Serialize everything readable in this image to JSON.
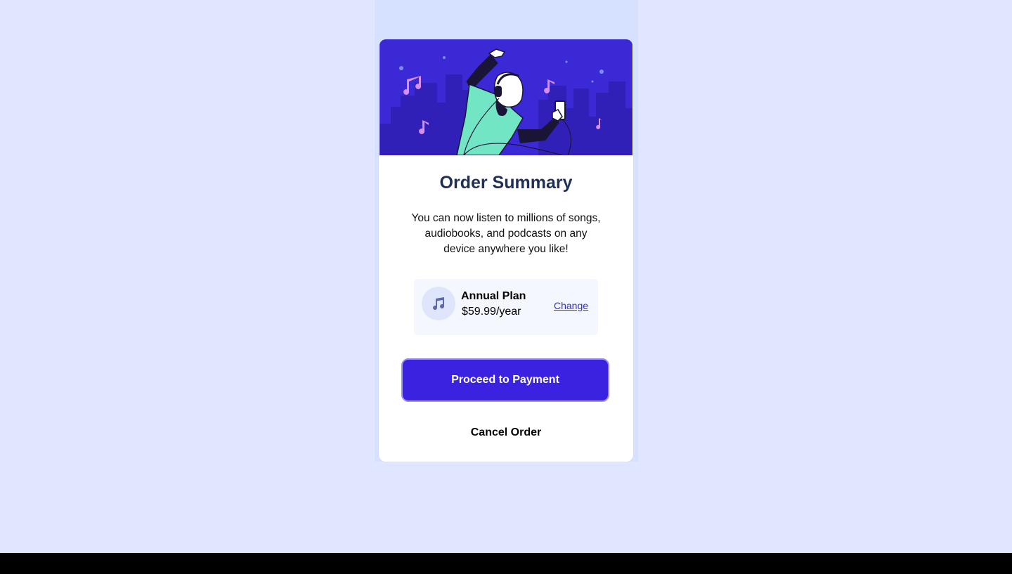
{
  "card": {
    "title": "Order Summary",
    "description": "You can now listen to millions of songs, audiobooks, and podcasts on any device anywhere you like!"
  },
  "plan": {
    "icon": "music-note-icon",
    "name": "Annual Plan",
    "price": "$59.99/year",
    "change_label": "Change"
  },
  "actions": {
    "proceed_label": "Proceed to Payment",
    "cancel_label": "Cancel Order"
  },
  "colors": {
    "page_background": "#e0e6ff",
    "hero_background": "#3b29d6",
    "primary_button": "#3a22e0",
    "title_text": "#1f2f56",
    "link": "#2e2fc4"
  },
  "hero": {
    "illustration": "dancing-person-with-headphones-illustration"
  }
}
